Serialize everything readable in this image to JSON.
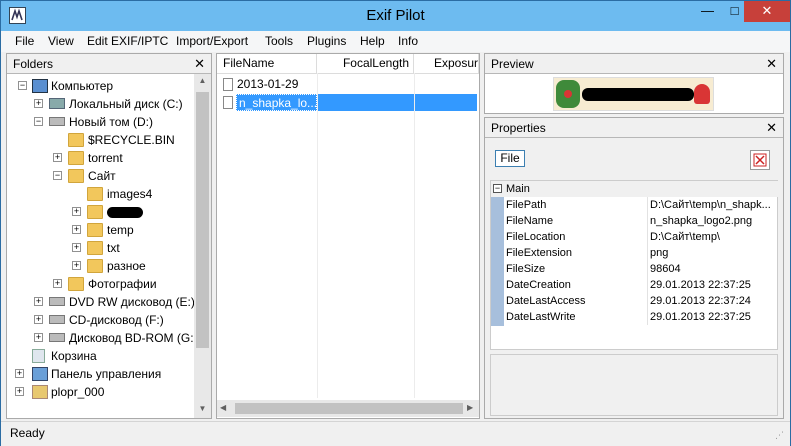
{
  "window": {
    "title": "Exif Pilot"
  },
  "menu": [
    "File",
    "View",
    "Edit EXIF/IPTC",
    "Import/Export",
    "Tools",
    "Plugins",
    "Help",
    "Info"
  ],
  "folders": {
    "title": "Folders",
    "tree": [
      {
        "label": "Компьютер",
        "icon": "computer-icon",
        "expander": "-"
      },
      {
        "label": "Локальный диск (C:)",
        "icon": "drive-icon",
        "expander": "+"
      },
      {
        "label": "Новый том (D:)",
        "icon": "drive-icon",
        "expander": "-"
      },
      {
        "label": "$RECYCLE.BIN",
        "icon": "folder-icon",
        "expander": ""
      },
      {
        "label": "torrent",
        "icon": "folder-icon",
        "expander": "+"
      },
      {
        "label": "Сайт",
        "icon": "folder-icon",
        "expander": "-"
      },
      {
        "label": "images4",
        "icon": "folder-icon",
        "expander": ""
      },
      {
        "label": "",
        "icon": "folder-icon",
        "expander": "+"
      },
      {
        "label": "temp",
        "icon": "folder-icon",
        "expander": "+"
      },
      {
        "label": "txt",
        "icon": "folder-icon",
        "expander": "+"
      },
      {
        "label": "разное",
        "icon": "folder-icon",
        "expander": "+"
      },
      {
        "label": "Фотографии",
        "icon": "folder-icon",
        "expander": "+"
      },
      {
        "label": "DVD RW дисковод (E:)",
        "icon": "dvd-drive-icon",
        "expander": "+"
      },
      {
        "label": "CD-дисковод (F:)",
        "icon": "cd-drive-icon",
        "expander": "+"
      },
      {
        "label": "Дисковод BD-ROM (G:",
        "icon": "bd-drive-icon",
        "expander": "+"
      },
      {
        "label": "Корзина",
        "icon": "recycle-bin-icon",
        "expander": ""
      },
      {
        "label": "Панель управления",
        "icon": "control-panel-icon",
        "expander": "+"
      },
      {
        "label": "plopr_000",
        "icon": "user-folder-icon",
        "expander": "+"
      }
    ]
  },
  "files": {
    "columns": [
      "FileName",
      "FocalLength",
      "Exposur"
    ],
    "rows": [
      {
        "name": "2013-01-29 2...",
        "selected": false
      },
      {
        "name": "n_shapka_lo...",
        "selected": true
      }
    ]
  },
  "preview": {
    "title": "Preview"
  },
  "properties": {
    "title": "Properties",
    "tab": "File",
    "group": "Main",
    "rows": [
      {
        "key": "FilePath",
        "value": "D:\\Сайт\\temp\\n_shapk..."
      },
      {
        "key": "FileName",
        "value": "n_shapka_logo2.png"
      },
      {
        "key": "FileLocation",
        "value": "D:\\Сайт\\temp\\"
      },
      {
        "key": "FileExtension",
        "value": "png"
      },
      {
        "key": "FileSize",
        "value": "98604"
      },
      {
        "key": "DateCreation",
        "value": "29.01.2013 22:37:25"
      },
      {
        "key": "DateLastAccess",
        "value": "29.01.2013 22:37:24"
      },
      {
        "key": "DateLastWrite",
        "value": "29.01.2013 22:37:25"
      }
    ]
  },
  "status": {
    "text": "Ready"
  },
  "colors": {
    "titlebar": "#6dbbf0",
    "selection": "#3399ff",
    "close": "#c7403a",
    "folder": "#f2c75c"
  }
}
